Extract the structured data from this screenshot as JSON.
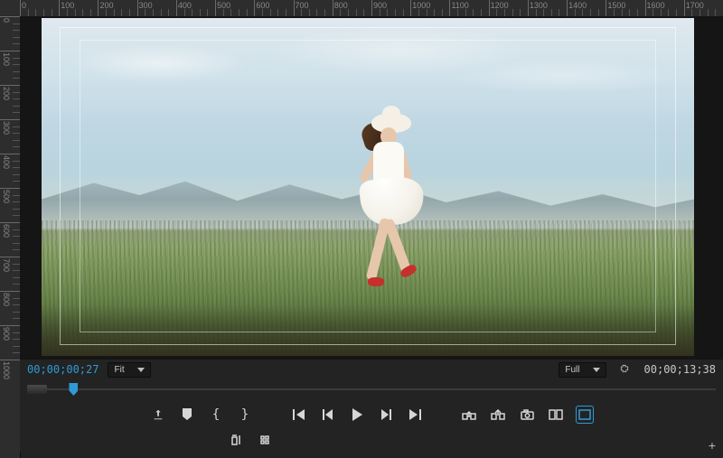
{
  "ruler": {
    "h_max": 1800,
    "h_step": 100,
    "v_max": 1000,
    "v_step": 100
  },
  "playback": {
    "current_timecode": "00;00;00;27",
    "total_timecode": "00;00;13;38",
    "zoom_label": "Fit",
    "resolution_label": "Full",
    "playhead_percent": 3.3
  },
  "icons": {
    "export": "export-icon",
    "marker": "marker-icon",
    "in_brace": "{",
    "out_brace": "}",
    "goto_in": "goto-in",
    "step_back": "step-back",
    "play": "play",
    "step_fwd": "step-fwd",
    "goto_out": "goto-out",
    "lift": "lift",
    "extract": "extract",
    "camera": "camera",
    "compare": "compare",
    "safe_margins": "safe-margins",
    "trim_mode": "trim-mode",
    "hash": "hash"
  }
}
